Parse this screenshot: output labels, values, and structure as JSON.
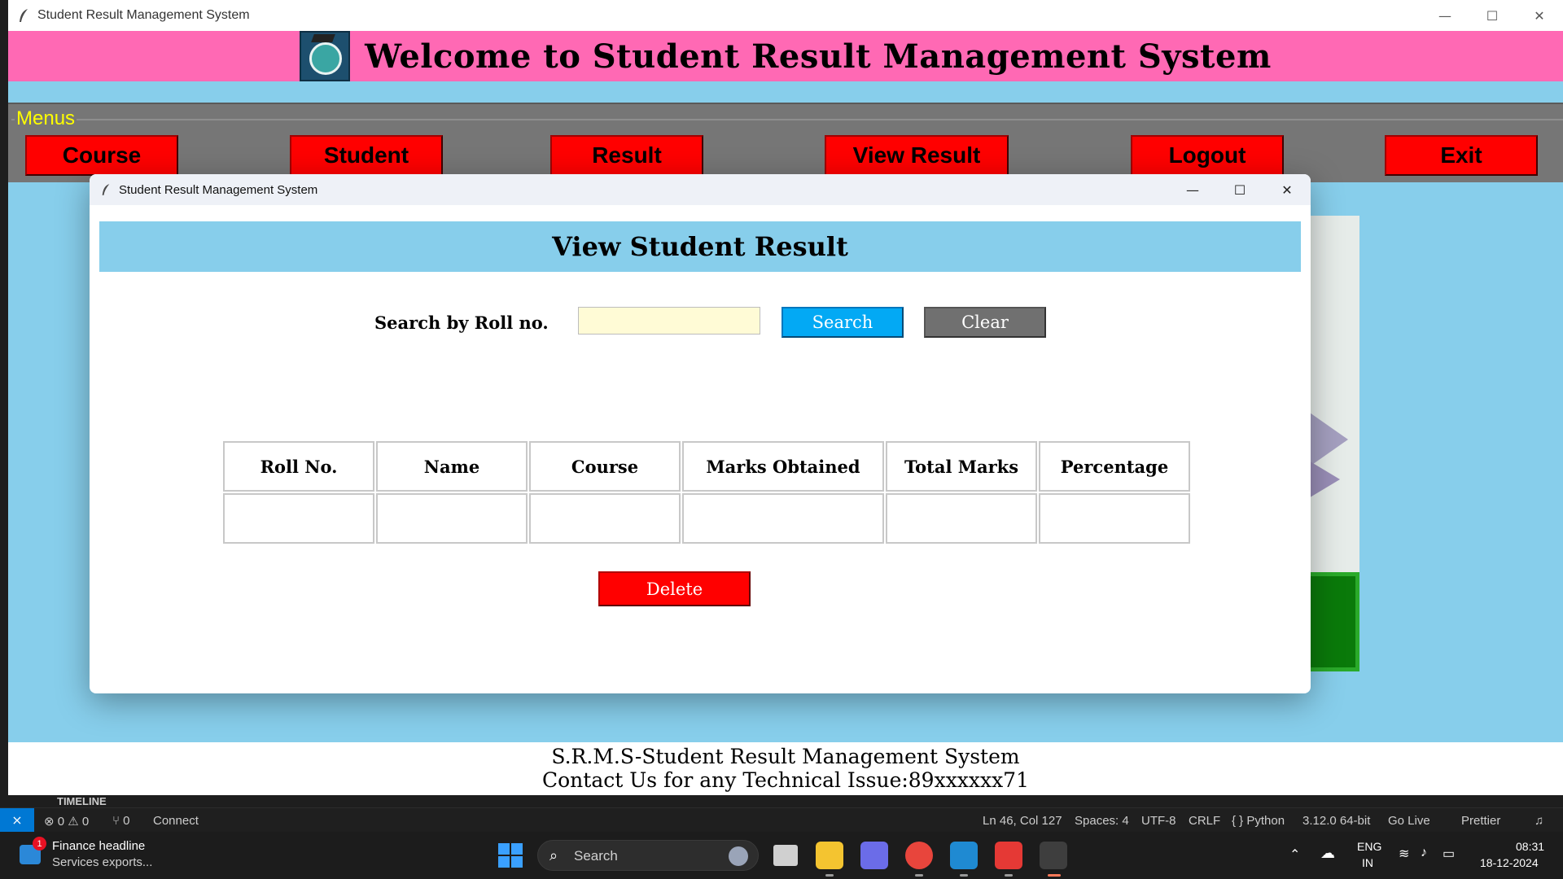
{
  "main_window": {
    "title": "Student Result Management System",
    "banner_title": "Welcome to Student Result Management System",
    "menu_legend": "Menus",
    "menu_buttons": [
      "Course",
      "Student",
      "Result",
      "View Result",
      "Logout",
      "Exit"
    ],
    "footer_line1": "S.R.M.S-Student Result Management System",
    "footer_line2": "Contact Us for any Technical Issue:89xxxxxx71"
  },
  "popup": {
    "title": "Student Result Management System",
    "heading": "View Student Result",
    "search_label": "Search by Roll no.",
    "search_value": "",
    "search_button": "Search",
    "clear_button": "Clear",
    "table_headers": [
      "Roll No.",
      "Name",
      "Course",
      "Marks Obtained",
      "Total Marks",
      "Percentage"
    ],
    "table_rows": [
      [
        "",
        "",
        "",
        "",
        "",
        ""
      ]
    ],
    "delete_button": "Delete"
  },
  "window_controls": {
    "minimize": "—",
    "maximize": "☐",
    "close": "✕"
  },
  "vscode": {
    "timeline_label": "TIMELINE",
    "status_left": [
      "⊗ 0 ⚠ 0",
      "⑂ 0",
      "Connect"
    ],
    "status_right": [
      "Ln 46, Col 127",
      "Spaces: 4",
      "UTF-8",
      "CRLF",
      "{ } Python",
      "3.12.0 64-bit",
      "Go Live",
      "Prettier"
    ]
  },
  "taskbar": {
    "news_badge": "1",
    "news_title": "Finance headline",
    "news_subtitle": "Services exports...",
    "search_placeholder": "Search",
    "language_top": "ENG",
    "language_bottom": "IN",
    "time": "08:31",
    "date": "18-12-2024"
  },
  "colors": {
    "banner": "#ff69b4",
    "background": "#87ceeb",
    "menu_button": "#ff0000",
    "search_button": "#03a9f4",
    "clear_button": "#707070",
    "input_bg": "#fffbd6",
    "menu_legend": "#ffff00"
  },
  "icons": [
    "feather-icon",
    "minimize-icon",
    "maximize-icon",
    "close-icon",
    "logo-icon",
    "windows-start-icon",
    "search-icon",
    "chevron-up-icon",
    "cloud-icon",
    "wifi-icon",
    "speaker-icon",
    "battery-icon",
    "bell-icon"
  ]
}
